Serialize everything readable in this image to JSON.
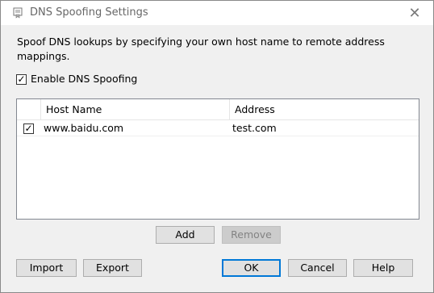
{
  "window": {
    "title": "DNS Spoofing Settings",
    "icon": "certificate-icon",
    "close_icon": "close-icon",
    "close_glyph": "✕"
  },
  "description": "Spoof DNS lookups by specifying your own host name to remote address mappings.",
  "enable": {
    "label": "Enable DNS Spoofing",
    "checked": true
  },
  "table": {
    "columns": [
      "Host Name",
      "Address"
    ],
    "rows": [
      {
        "checked": true,
        "host": "www.baidu.com",
        "address": "test.com"
      }
    ]
  },
  "buttons": {
    "add": "Add",
    "remove": "Remove",
    "import": "Import",
    "export": "Export",
    "ok": "OK",
    "cancel": "Cancel",
    "help": "Help"
  },
  "check_glyph": "✓"
}
